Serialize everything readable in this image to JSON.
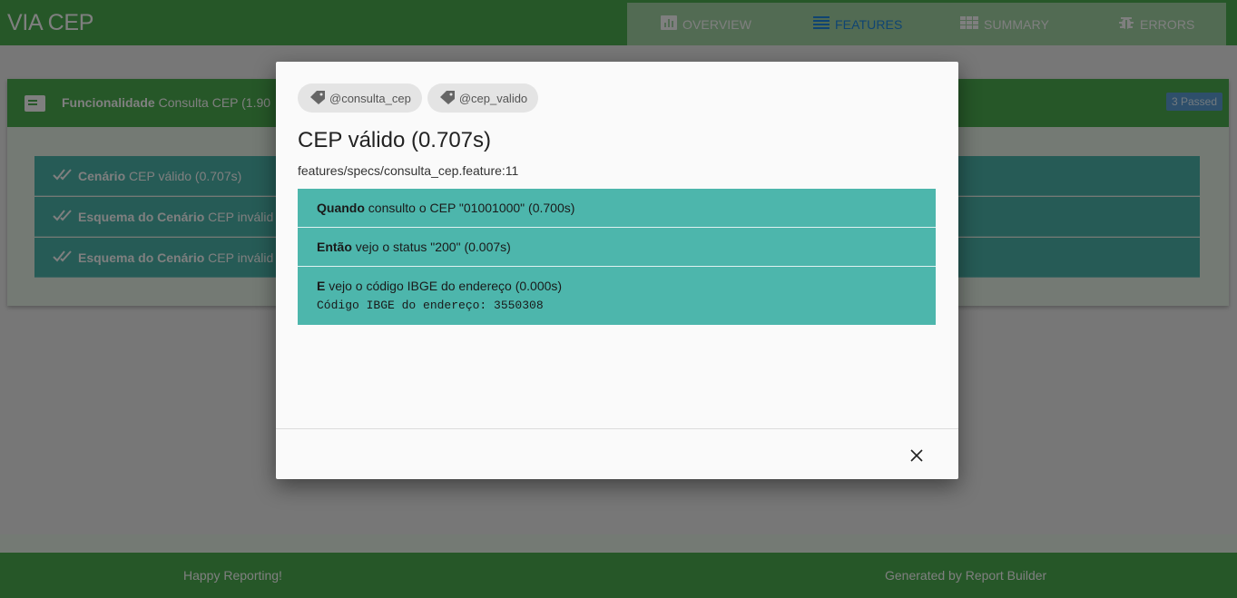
{
  "header": {
    "brand": "VIA CEP",
    "nav": [
      {
        "label": "OVERVIEW",
        "icon": "bar-chart-icon"
      },
      {
        "label": "FEATURES",
        "icon": "list-icon"
      },
      {
        "label": "SUMMARY",
        "icon": "table-icon"
      },
      {
        "label": "ERRORS",
        "icon": "bug-icon"
      }
    ],
    "active_nav": "FEATURES",
    "colors": {
      "primary": "#4caf50",
      "active": "#1e88e5",
      "step": "#4db6ac"
    }
  },
  "feature": {
    "keyword": "Funcionalidade",
    "text": "Consulta CEP (1.90",
    "badge": "3 Passed",
    "scenarios": [
      {
        "keyword": "Cenário",
        "text": "CEP válido (0.707s)"
      },
      {
        "keyword": "Esquema do Cenário",
        "text": "CEP inválid"
      },
      {
        "keyword": "Esquema do Cenário",
        "text": "CEP inválid"
      }
    ]
  },
  "footer": {
    "left": "Happy Reporting!",
    "right": "Generated by Report Builder"
  },
  "modal": {
    "tags": [
      "@consulta_cep",
      "@cep_valido"
    ],
    "title": "CEP válido (0.707s)",
    "path": "features/specs/consulta_cep.feature:11",
    "steps": [
      {
        "keyword": "Quando",
        "text": " consulto o CEP \"01001000\" (0.700s)",
        "output": ""
      },
      {
        "keyword": "Então",
        "text": " vejo o status \"200\" (0.007s)",
        "output": ""
      },
      {
        "keyword": "E",
        "text": " vejo o código IBGE do endereço (0.000s)",
        "output": "Código IBGE do endereço: 3550308"
      }
    ],
    "close_icon": "close-icon"
  }
}
